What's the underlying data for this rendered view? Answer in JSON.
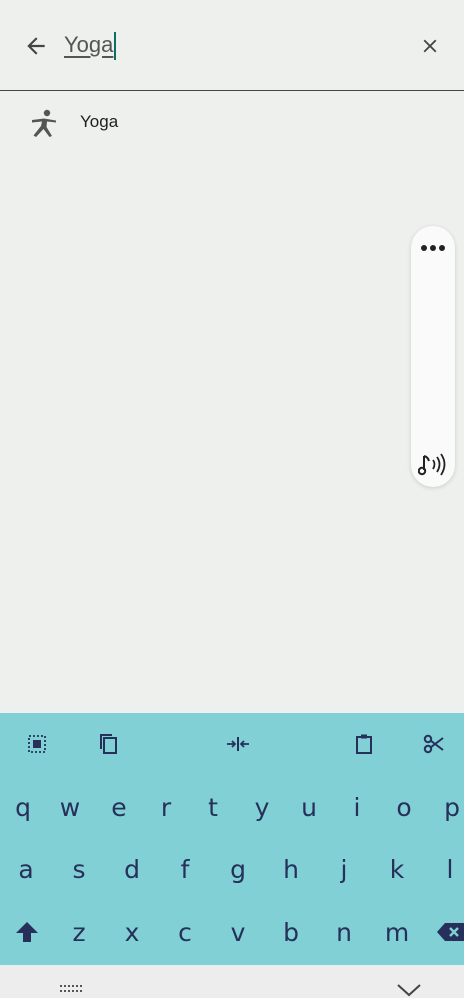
{
  "search": {
    "query": "Yoga"
  },
  "results": [
    {
      "label": "Yoga",
      "icon": "yoga-pose-icon"
    }
  ],
  "side_panel": {
    "items": [
      "more-options-icon",
      "sound-music-icon"
    ]
  },
  "keyboard": {
    "toolbar": [
      "select-all-icon",
      "copy-icon",
      "cursor-split-icon",
      "clipboard-icon",
      "cut-icon"
    ],
    "row1": [
      "q",
      "w",
      "e",
      "r",
      "t",
      "y",
      "u",
      "i",
      "o",
      "p"
    ],
    "row2": [
      "a",
      "s",
      "d",
      "f",
      "g",
      "h",
      "j",
      "k",
      "l"
    ],
    "row3": [
      "z",
      "x",
      "c",
      "v",
      "b",
      "n",
      "m"
    ],
    "colors": {
      "background": "#80d0d5",
      "key_text": "#26305a"
    }
  },
  "colors": {
    "page_bg": "#edf0ed",
    "accent": "#0b6e63"
  }
}
